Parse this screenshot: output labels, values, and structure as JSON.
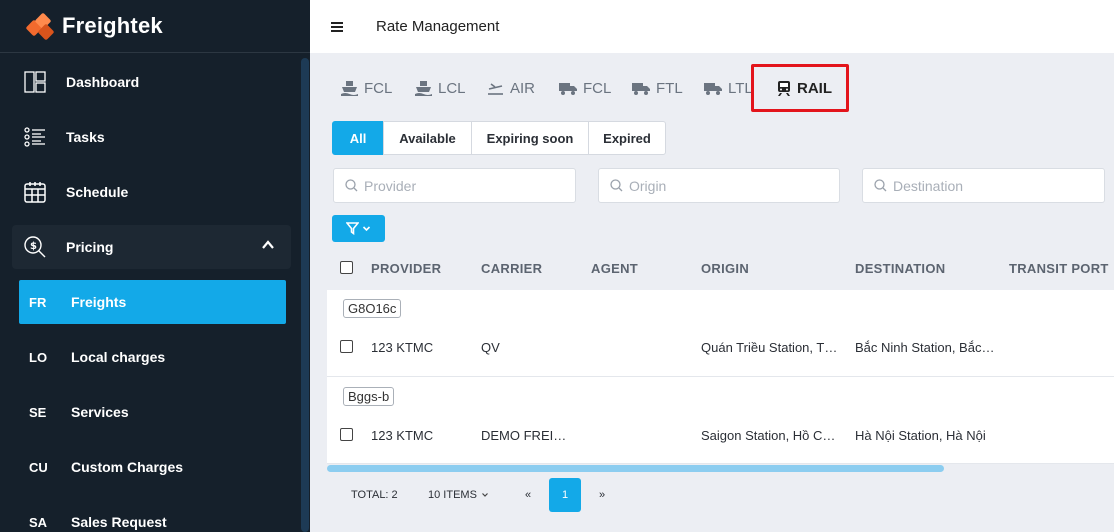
{
  "app": {
    "name": "Freightek"
  },
  "sidebar": {
    "items": [
      {
        "label": "Dashboard"
      },
      {
        "label": "Tasks"
      },
      {
        "label": "Schedule"
      },
      {
        "label": "Pricing"
      }
    ],
    "sub_items": [
      {
        "abbr": "FR",
        "label": "Freights"
      },
      {
        "abbr": "LO",
        "label": "Local charges"
      },
      {
        "abbr": "SE",
        "label": "Services"
      },
      {
        "abbr": "CU",
        "label": "Custom Charges"
      },
      {
        "abbr": "SA",
        "label": "Sales Request"
      }
    ]
  },
  "header": {
    "title": "Rate Management"
  },
  "mode_tabs": [
    {
      "label": "FCL",
      "icon": "ship-icon"
    },
    {
      "label": "LCL",
      "icon": "ship-icon"
    },
    {
      "label": "AIR",
      "icon": "plane-icon"
    },
    {
      "label": "FCL",
      "icon": "truck-icon"
    },
    {
      "label": "FTL",
      "icon": "truck-icon"
    },
    {
      "label": "LTL",
      "icon": "truck-icon"
    },
    {
      "label": "RAIL",
      "icon": "train-icon"
    }
  ],
  "status_filters": [
    {
      "label": "All"
    },
    {
      "label": "Available"
    },
    {
      "label": "Expiring soon"
    },
    {
      "label": "Expired"
    }
  ],
  "search": {
    "provider_placeholder": "Provider",
    "origin_placeholder": "Origin",
    "destination_placeholder": "Destination"
  },
  "table": {
    "columns": [
      "PROVIDER",
      "CARRIER",
      "AGENT",
      "ORIGIN",
      "DESTINATION",
      "TRANSIT PORT"
    ],
    "groups": [
      {
        "tag": "G8O16c",
        "row": {
          "provider": "123 KTMC",
          "carrier": "QV",
          "agent": "",
          "origin": "Quán Triều Station, Thái Nguyên",
          "destination": "Bắc Ninh Station, Bắc Ninh"
        }
      },
      {
        "tag": "Bggs-b",
        "row": {
          "provider": "123 KTMC",
          "carrier": "DEMO FREIGHT",
          "agent": "",
          "origin": "Saigon Station, Hồ Chí Minh",
          "destination": "Hà Nội Station, Hà Nội"
        }
      }
    ]
  },
  "pagination": {
    "total": "TOTAL: 2",
    "page_size": "10 ITEMS",
    "prev": "«",
    "current_page": "1",
    "next": "»"
  },
  "colors": {
    "accent": "#13a9e8",
    "sidebar_bg": "#15202b",
    "highlight": "#e3141b"
  }
}
